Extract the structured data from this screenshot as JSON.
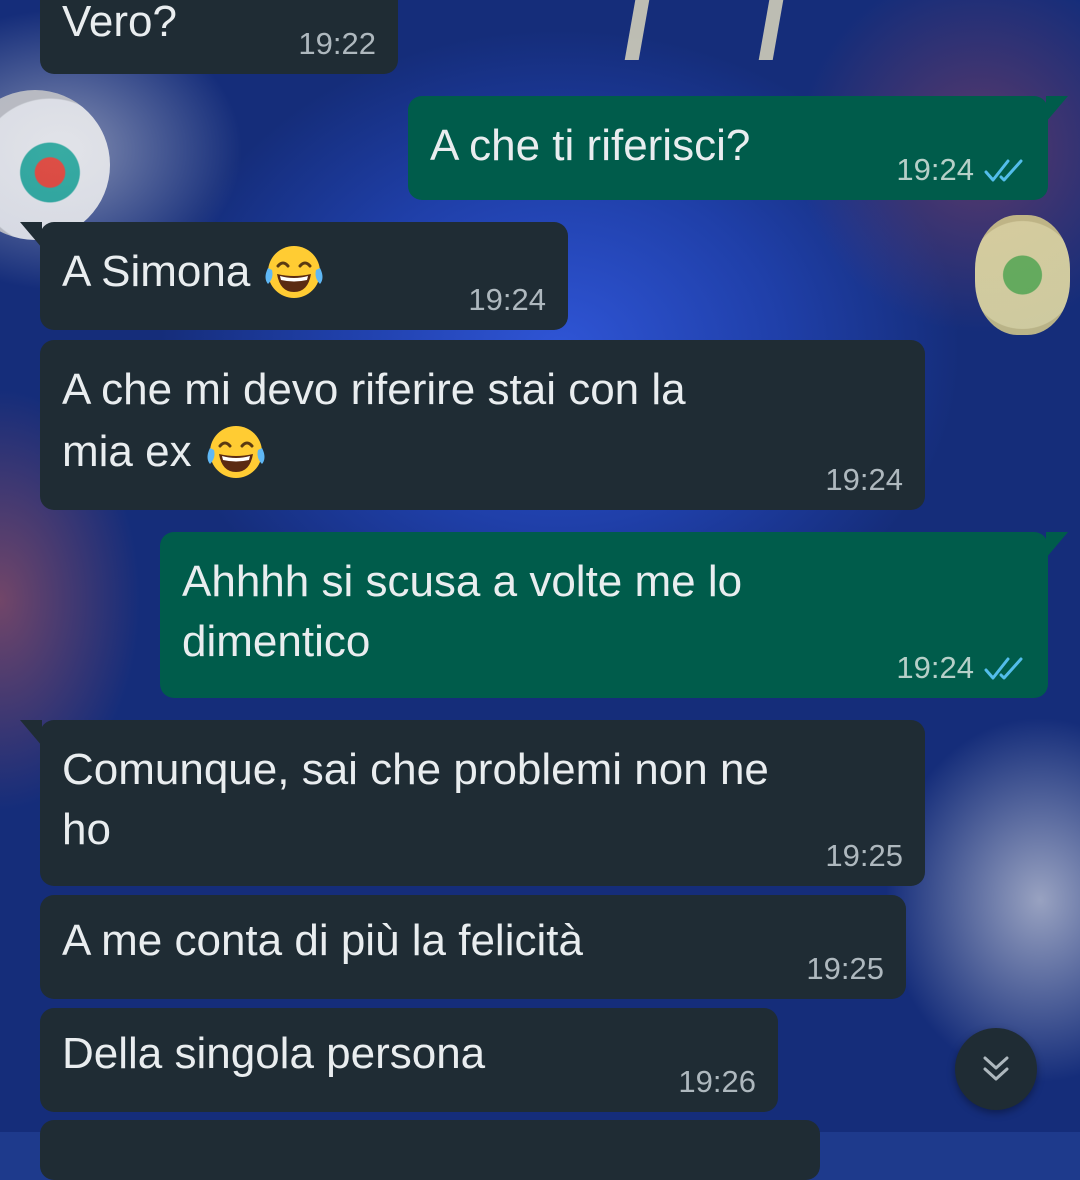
{
  "wallpaper": {
    "description_icon": "football-jersey-wallpaper"
  },
  "colors": {
    "incoming_bubble": "#1f2c34",
    "outgoing_bubble": "#005c4b",
    "text": "#e9edef",
    "timestamp": "#aeb8be",
    "read_ticks": "#53bdeb"
  },
  "messages": [
    {
      "direction": "incoming",
      "text": "Vero?",
      "time": "19:22"
    },
    {
      "direction": "outgoing",
      "text": "A che ti riferisci?",
      "time": "19:24",
      "status": "read"
    },
    {
      "direction": "incoming",
      "text": "A Simona",
      "emoji": "face-with-tears-of-joy",
      "time": "19:24"
    },
    {
      "direction": "incoming",
      "text_line1": "A che mi devo riferire stai con la",
      "text_line2": "mia ex",
      "emoji": "face-with-tears-of-joy",
      "time": "19:24"
    },
    {
      "direction": "outgoing",
      "text_line1": "Ahhhh si scusa a volte me lo",
      "text_line2": "dimentico",
      "time": "19:24",
      "status": "read"
    },
    {
      "direction": "incoming",
      "text_line1": "Comunque, sai che problemi non ne",
      "text_line2": "ho",
      "time": "19:25"
    },
    {
      "direction": "incoming",
      "text": "A me conta di più la felicità",
      "time": "19:25"
    },
    {
      "direction": "incoming",
      "text": "Della singola persona",
      "time": "19:26"
    }
  ],
  "scroll_button": {
    "icon": "double-chevron-down-icon"
  }
}
